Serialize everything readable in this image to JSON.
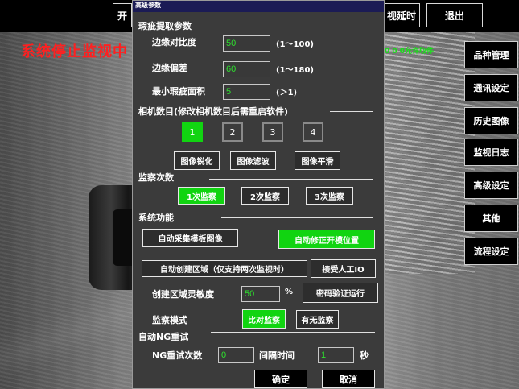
{
  "top_bar": {
    "left_partial": "开",
    "right_partial": "视延时",
    "exit": "退出"
  },
  "main": {
    "status_banner": "系统停止监视中",
    "permit_text": "0 0 0允许取件"
  },
  "sidebar": {
    "items": [
      {
        "label": "品种管理"
      },
      {
        "label": "通讯设定"
      },
      {
        "label": "历史图像"
      },
      {
        "label": "监视日志"
      },
      {
        "label": "高级设定"
      },
      {
        "label": "其他"
      },
      {
        "label": "流程设定"
      }
    ]
  },
  "dialog": {
    "title": "高级参数",
    "defect_section": {
      "title": "瑕疵提取参数",
      "edge_contrast": {
        "label": "边缘对比度",
        "value": "50",
        "range": "(1～100)"
      },
      "edge_offset": {
        "label": "边缘偏差",
        "value": "60",
        "range": "(1～180)"
      },
      "min_defect_area": {
        "label": "最小瑕疵面积",
        "value": "5",
        "range": "(＞1)"
      }
    },
    "camera_section": {
      "title": "相机数目(修改相机数目后需重启软件)",
      "options": [
        "1",
        "2",
        "3",
        "4"
      ],
      "selected": "1"
    },
    "image_buttons": {
      "sharpen": "图像锐化",
      "filter": "图像滤波",
      "smooth": "图像平滑"
    },
    "monitor_count": {
      "title": "监察次数",
      "options": [
        "1次监察",
        "2次监察",
        "3次监察"
      ],
      "selected": "1次监察"
    },
    "system_functions": {
      "title": "系统功能",
      "auto_collect_template": "自动采集模板图像",
      "auto_correct_open_position": "自动修正开模位置",
      "auto_create_region": "自动创建区域（仅支持两次监视时）",
      "accept_manual_io": "接受人工IO",
      "region_sensitivity_label": "创建区域灵敏度",
      "region_sensitivity_value": "50",
      "percent_unit": "%",
      "password_run": "密码验证运行",
      "monitor_mode_label": "监察模式",
      "mode_compare": "比对监察",
      "mode_presence": "有无监察"
    },
    "ng_retry": {
      "title": "自动NG重试",
      "count_label": "NG重试次数",
      "count_value": "0",
      "interval_label": "间隔时间",
      "interval_value": "1",
      "unit": "秒"
    },
    "confirm": "确定",
    "cancel": "取消"
  },
  "colors": {
    "active_green": "#11d411",
    "input_text_green": "#2ee02e",
    "banner_red": "#ff2020",
    "dialog_bg": "#3b3b3b",
    "titlebar_bg": "#1b1b55"
  }
}
